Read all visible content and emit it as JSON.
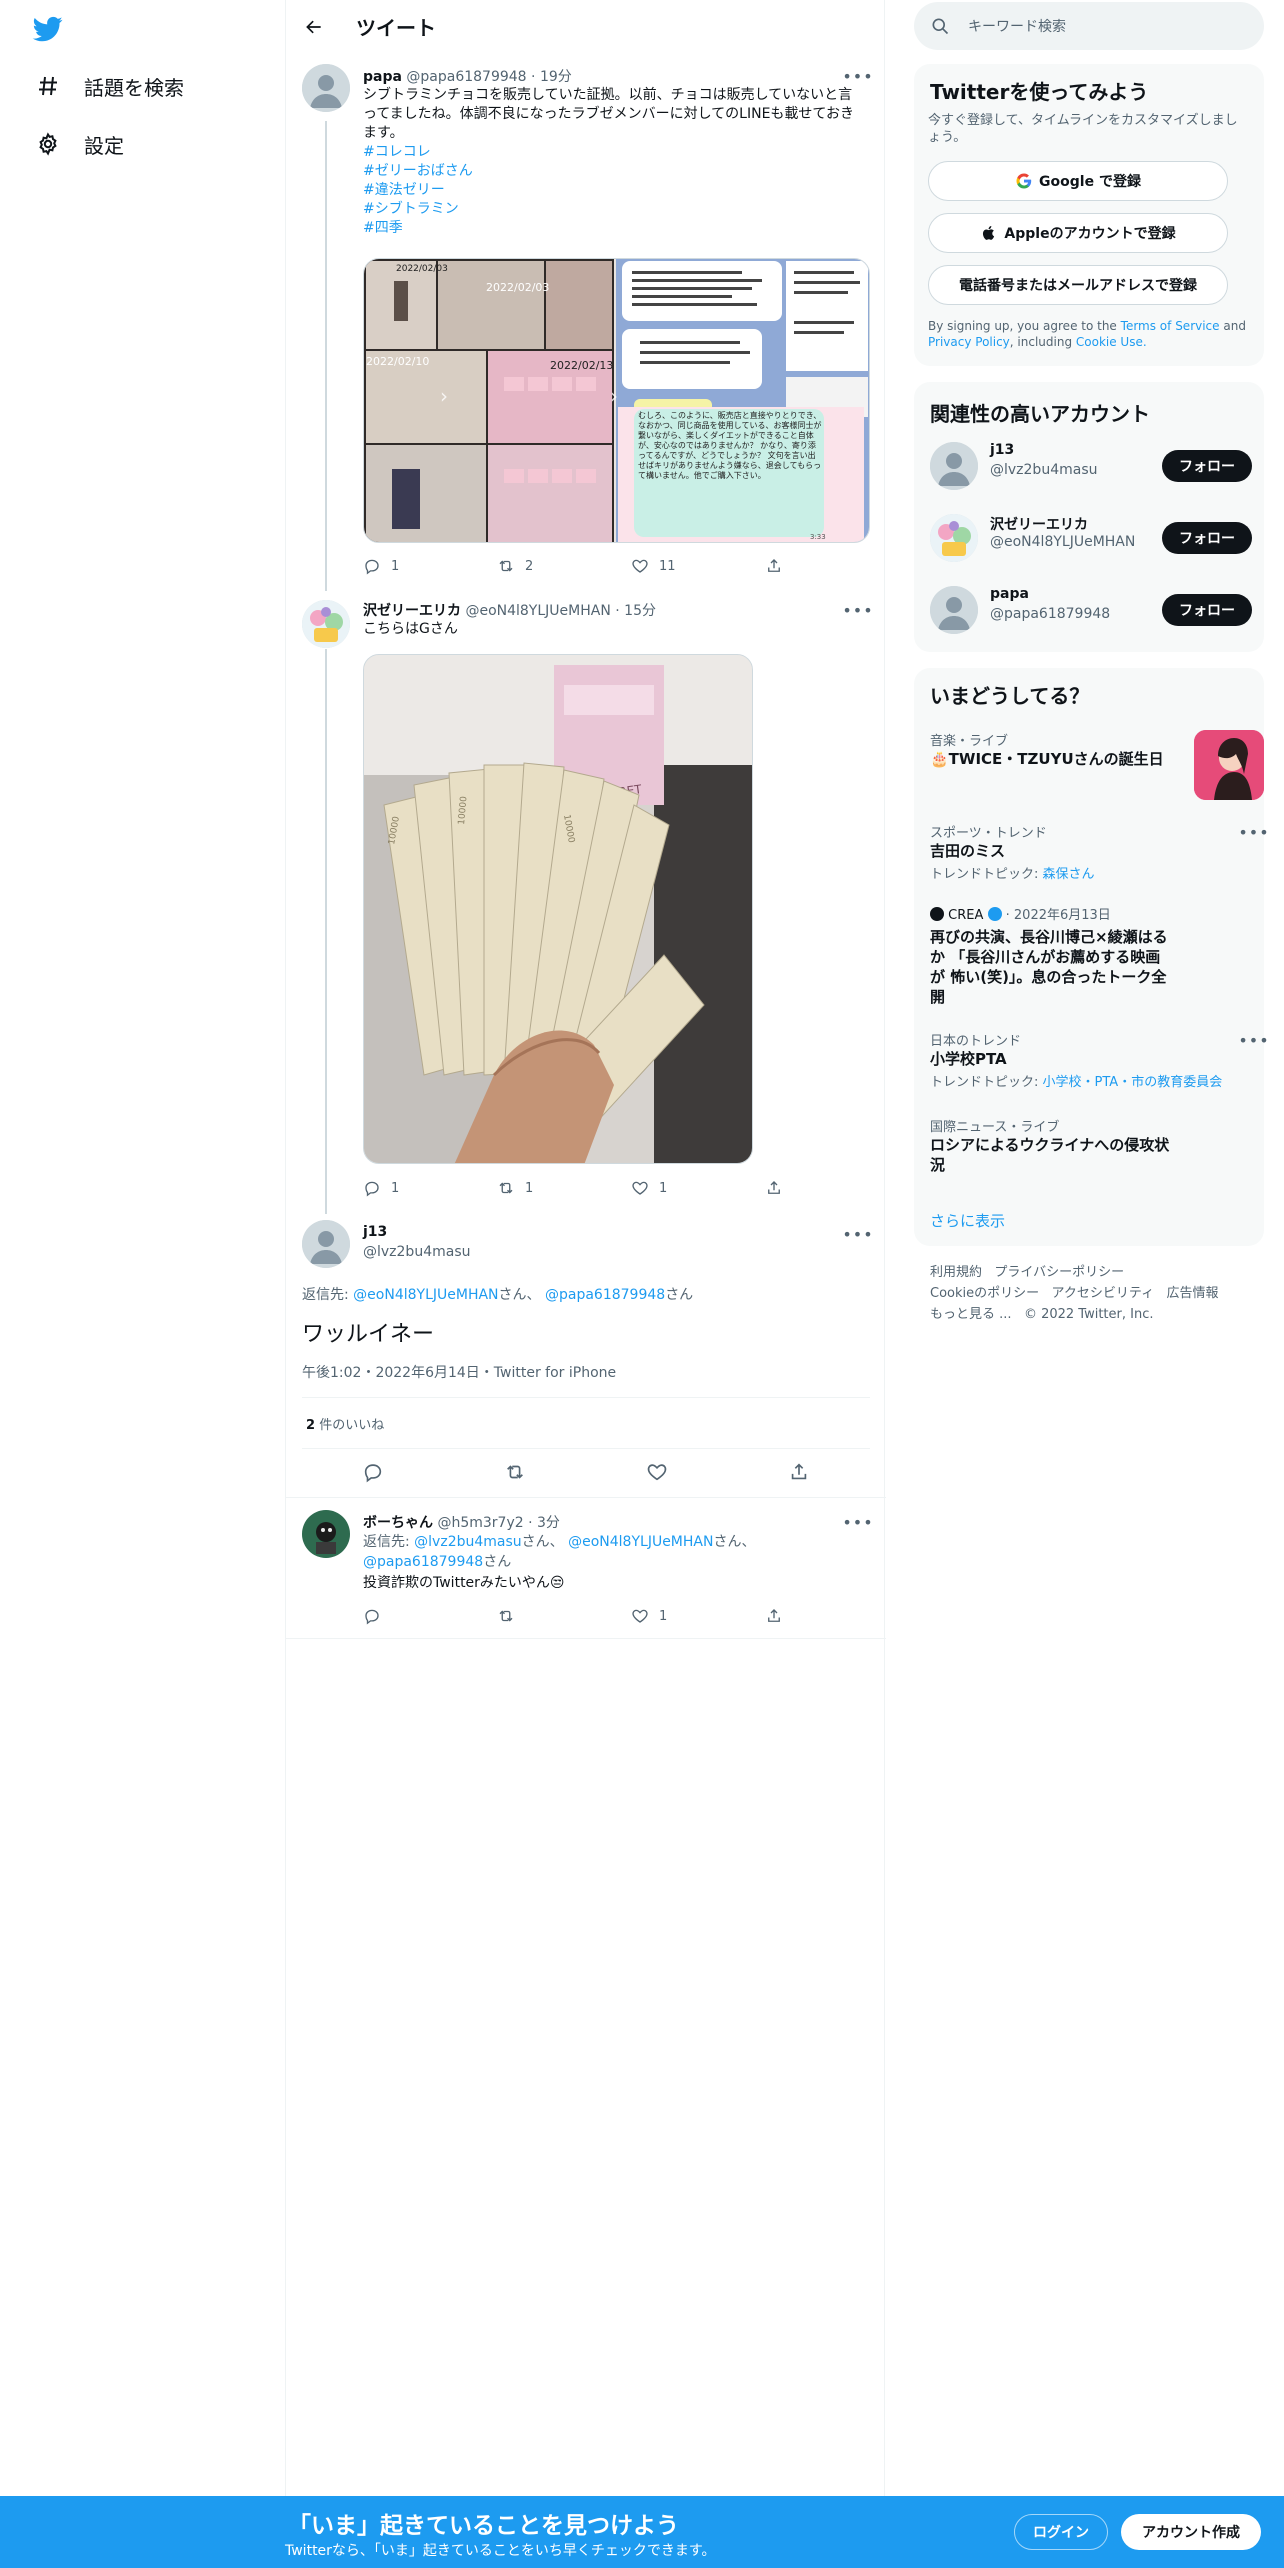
{
  "colors": {
    "accent": "#1d9bf0",
    "text": "#0f1419",
    "secondary": "#536471",
    "border": "#eff3f4",
    "bottom_bar": "#1d9bf0"
  },
  "nav": {
    "logo_icon": "twitter-bird-icon",
    "explore": {
      "label": "話題を検索",
      "icon": "hashtag-icon"
    },
    "settings": {
      "label": "設定",
      "icon": "gear-icon"
    }
  },
  "header": {
    "title": "ツイート",
    "back_icon": "back-arrow-icon"
  },
  "tweets": [
    {
      "name": "papa",
      "handle": "@papa61879948",
      "time": "19分",
      "text": "シブトラミンチョコを販売していた証拠。以前、チョコは販売していないと言ってましたね。体調不良になったラブゼメンバーに対してのLINEも載せておきます。",
      "hashtags": [
        "#コレコレ",
        "#ゼリーおばさん",
        "#違法ゼリー",
        "#シブトラミン",
        "#四季"
      ],
      "images": {
        "dates": [
          "2022/02/03",
          "2022/02/03",
          "2022/02/10",
          "2022/02/13"
        ],
        "chat_text": "むしろ、このように、販売店と直接やりとりでき、なおかつ、同じ商品を使用している、お客様同士が繋いながら、楽しくダイエットができること自体が、安心なのではありませんか？ かなり、寄り添ってるんですが、どうでしょうか？ 文句を言い出せばキリがありませんよう嫌なら、退会してもらって構いません。他でご購入下さい。",
        "chat_time": "3:33"
      },
      "replies": "1",
      "retweets": "2",
      "likes": "11"
    },
    {
      "name": "沢ゼリーエリカ",
      "handle": "@eoN4l8YLJUeMHAN",
      "time": "15分",
      "text": "こちらはGさん",
      "image_text": "DETOXERET",
      "replies": "1",
      "retweets": "1",
      "likes": "1"
    }
  ],
  "focused": {
    "name": "j13",
    "handle": "@lvz2bu4masu",
    "reply_prefix": "返信先:",
    "reply_to_1": "@eoN4l8YLJUeMHAN",
    "reply_sep_1": "さん、",
    "reply_to_2": "@papa61879948",
    "reply_sep_2": "さん",
    "text": "ワッルイネー",
    "meta": "午後1:02・2022年6月14日・Twitter for iPhone",
    "likes_count": "2",
    "likes_label": "件のいいね"
  },
  "reply": {
    "name": "ボーちゃん",
    "handle": "@h5m3r7y2",
    "time": "3分",
    "reply_prefix": "返信先:",
    "reply_to_1": "@lvz2bu4masu",
    "reply_sep_1": "さん、",
    "reply_to_2": "@eoN4l8YLJUeMHAN",
    "reply_sep_2": "さん、",
    "reply_to_3": "@papa61879948",
    "reply_sep_3": "さん",
    "text": "投資詐欺のTwitterみたいやん😒",
    "replies": "",
    "retweets": "",
    "likes": "1"
  },
  "search": {
    "placeholder": "キーワード検索"
  },
  "signup_box": {
    "title": "Twitterを使ってみよう",
    "subtitle": "今すぐ登録して、タイムラインをカスタマイズしましょう。",
    "google": "Google で登録",
    "apple": "Appleのアカウントで登録",
    "phone": "電話番号またはメールアドレスで登録",
    "terms_pre": "By signing up, you agree to the",
    "terms": "Terms of Service",
    "and": "and",
    "privacy": "Privacy Policy",
    "including": ", including",
    "cookie": "Cookie Use."
  },
  "related": {
    "title": "関連性の高いアカウント",
    "follow_label": "フォロー",
    "accounts": [
      {
        "name": "j13",
        "handle": "@lvz2bu4masu"
      },
      {
        "name": "沢ゼリーエリカ",
        "handle": "@eoN4l8YLJUeMHAN"
      },
      {
        "name": "papa",
        "handle": "@papa61879948"
      }
    ]
  },
  "trends": {
    "title": "いまどうしてる？",
    "items": [
      {
        "category": "音楽・ライブ",
        "title": "🎂TWICE・TZUYUさんの誕生日"
      },
      {
        "category": "スポーツ・トレンド",
        "title": "吉田のミス",
        "topic_label": "トレンドトピック:",
        "topic": "森保さん"
      },
      {
        "source": "CREA",
        "date": "2022年6月13日",
        "title": "再びの共演、長谷川博己×綾瀬はるか 「長谷川さんがお薦めする映画が 怖い(笑)」。息の合ったトーク全開"
      },
      {
        "category": "日本のトレンド",
        "title": "小学校PTA",
        "topic_label": "トレンドトピック:",
        "topic": "小学校・PTA・市の教育委員会"
      },
      {
        "category": "国際ニュース・ライブ",
        "title": "ロシアによるウクライナへの侵攻状況"
      }
    ],
    "show_more": "さらに表示"
  },
  "footer": {
    "terms": "利用規約",
    "privacy": "プライバシーポリシー",
    "cookie": "Cookieのポリシー",
    "accessibility": "アクセシビリティ",
    "ads": "広告情報",
    "more": "もっと見る ...",
    "copyright": "© 2022 Twitter, Inc."
  },
  "bottom_bar": {
    "title": "「いま」起きていることを見つけよう",
    "subtitle": "Twitterなら、「いま」起きていることをいち早くチェックできます。",
    "login": "ログイン",
    "signup": "アカウント作成"
  }
}
